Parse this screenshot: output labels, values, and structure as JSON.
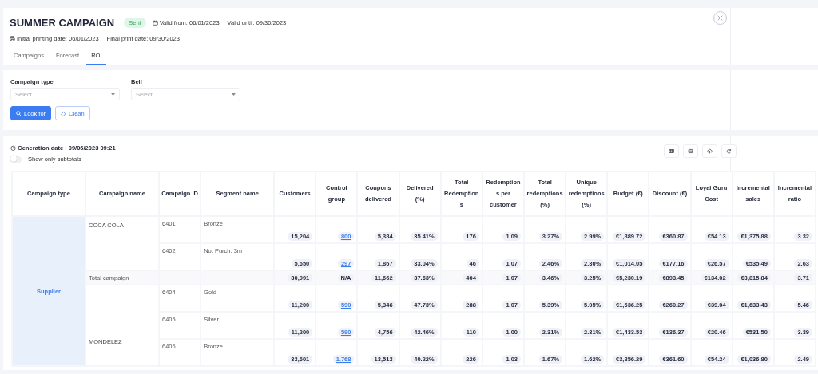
{
  "header": {
    "title": "SUMMER CAMPAIGN",
    "status": "Sent",
    "valid_from": "Valid from: 06/01/2023",
    "valid_until": "Valid until: 09/30/2023",
    "initial_printing": "Initial printing date: 06/01/2023",
    "final_print": "Final print date: 09/30/2023"
  },
  "tabs": [
    {
      "label": "Campaigns",
      "selected": false
    },
    {
      "label": "Forecast",
      "selected": false
    },
    {
      "label": "ROI",
      "selected": true
    }
  ],
  "filters": [
    {
      "label": "Campaign type",
      "placeholder": "Select..."
    },
    {
      "label": "Bell",
      "placeholder": "Select..."
    }
  ],
  "buttons": [
    {
      "kind": "primary",
      "label": "Look for"
    },
    {
      "kind": "secondary",
      "label": "Clean"
    }
  ],
  "generation_date": "Generation date : 09/06/2023 09:21",
  "subtotals_toggle": {
    "label": "Show only subtotals",
    "on": false
  },
  "table": {
    "columns": [
      "Campaign type",
      "Campaign name",
      "Campaign ID",
      "Segment name",
      "Customers",
      "Control group",
      "Coupons delivered",
      "Delivered (%)",
      "Total Redemptions",
      "Redemptions per customer",
      "Total redemptions (%)",
      "Unique redemptions (%)",
      "Budget (€)",
      "Discount (€)",
      "Loyal Guru Cost",
      "Incremental sales",
      "Incremental ratio"
    ],
    "groups": [
      {
        "type": "Supplier",
        "items": [
          {
            "kind": "campaign",
            "name": "COCA COLA",
            "segments": [
              {
                "id": "6401",
                "segment": "Bronze",
                "control_group_linked": true,
                "values": [
                  "15,204",
                  "800",
                  "5,384",
                  "35.41%",
                  "176",
                  "1.09",
                  "3.27%",
                  "2.99%",
                  "€1,889.72",
                  "€360.87",
                  "€54.13",
                  "€1,375.88",
                  "3.32"
                ]
              },
              {
                "id": "6402",
                "segment": "Not Purch. 3m",
                "control_group_linked": true,
                "values": [
                  "5,650",
                  "297",
                  "1,867",
                  "33.04%",
                  "46",
                  "1.07",
                  "2.46%",
                  "2.30%",
                  "€1,014.05",
                  "€177.16",
                  "€26.57",
                  "€535.49",
                  "2.63"
                ]
              }
            ]
          },
          {
            "kind": "total",
            "label": "Total campaign",
            "control_group_linked": false,
            "values": [
              "30,991",
              "N/A",
              "11,662",
              "37.63%",
              "404",
              "1.07",
              "3.46%",
              "3.25%",
              "€5,230.19",
              "€893.45",
              "€134.02",
              "€3,815.84",
              "3.71"
            ]
          },
          {
            "kind": "campaign",
            "name": "MONDELEZ",
            "segments": [
              {
                "id": "6404",
                "segment": "Gold",
                "control_group_linked": true,
                "values": [
                  "11,200",
                  "590",
                  "5,346",
                  "47.73%",
                  "288",
                  "1.07",
                  "5.39%",
                  "5.05%",
                  "€1,636.25",
                  "€260.27",
                  "€39.04",
                  "€1,633.43",
                  "5.46"
                ]
              },
              {
                "id": "6405",
                "segment": "Silver",
                "control_group_linked": true,
                "values": [
                  "11,200",
                  "590",
                  "4,756",
                  "42.46%",
                  "110",
                  "1.00",
                  "2.31%",
                  "2.31%",
                  "€1,433.53",
                  "€136.37",
                  "€20.46",
                  "€531.50",
                  "3.39"
                ]
              },
              {
                "id": "6406",
                "segment": "Bronze",
                "control_group_linked": true,
                "values": [
                  "33,601",
                  "1,768",
                  "13,513",
                  "40.22%",
                  "226",
                  "1.03",
                  "1.67%",
                  "1.62%",
                  "€3,856.29",
                  "€361.60",
                  "€54.24",
                  "€1,036.80",
                  "2.49"
                ]
              }
            ]
          }
        ]
      }
    ]
  }
}
